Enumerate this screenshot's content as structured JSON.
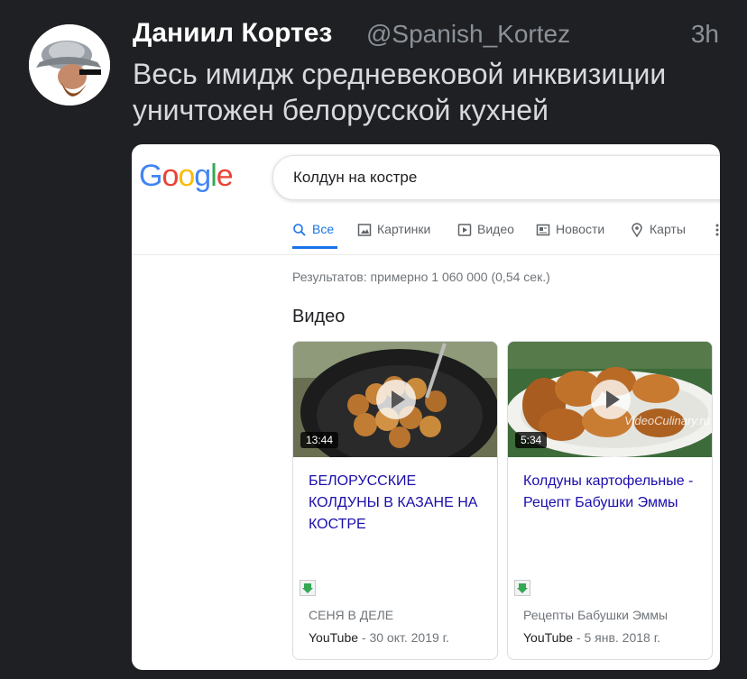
{
  "tweet": {
    "display_name": "Даниил Кортез",
    "handle": "@Spanish_Kortez",
    "time": "3h",
    "text": "Весь имидж средневековой инквизиции уничтожен белорусской кухней"
  },
  "search": {
    "logo": [
      "G",
      "o",
      "o",
      "g",
      "l",
      "e"
    ],
    "logo_colors": [
      "#4285f4",
      "#ea4335",
      "#fbbc05",
      "#4285f4",
      "#34a853",
      "#ea4335"
    ],
    "query": "Колдун на костре",
    "tabs": [
      {
        "label": "Все",
        "icon": "search-icon"
      },
      {
        "label": "Картинки",
        "icon": "image-icon"
      },
      {
        "label": "Видео",
        "icon": "video-icon"
      },
      {
        "label": "Новости",
        "icon": "news-icon"
      },
      {
        "label": "Карты",
        "icon": "map-pin-icon"
      },
      {
        "label": "",
        "icon": "more-icon"
      }
    ],
    "result_stats": "Результатов: примерно 1 060 000 (0,54 сек.)",
    "section_title": "Видео",
    "accent": "#1a73e8",
    "link_color": "#1a0dab",
    "videos": [
      {
        "duration": "13:44",
        "title": "БЕЛОРУССКИЕ КОЛДУНЫ В КАЗАНЕ НА КОСТРЕ",
        "channel": "СЕНЯ В ДЕЛЕ",
        "source": "YouTube",
        "date": " - 30 окт. 2019 г.",
        "watermark": ""
      },
      {
        "duration": "5:34",
        "title": "Колдуны картофельные - Рецепт Бабушки Эммы",
        "channel": "Рецепты Бабушки Эммы",
        "source": "YouTube",
        "date": " - 5 янв. 2018 г.",
        "watermark": "VideoCulinary.ru"
      }
    ]
  }
}
